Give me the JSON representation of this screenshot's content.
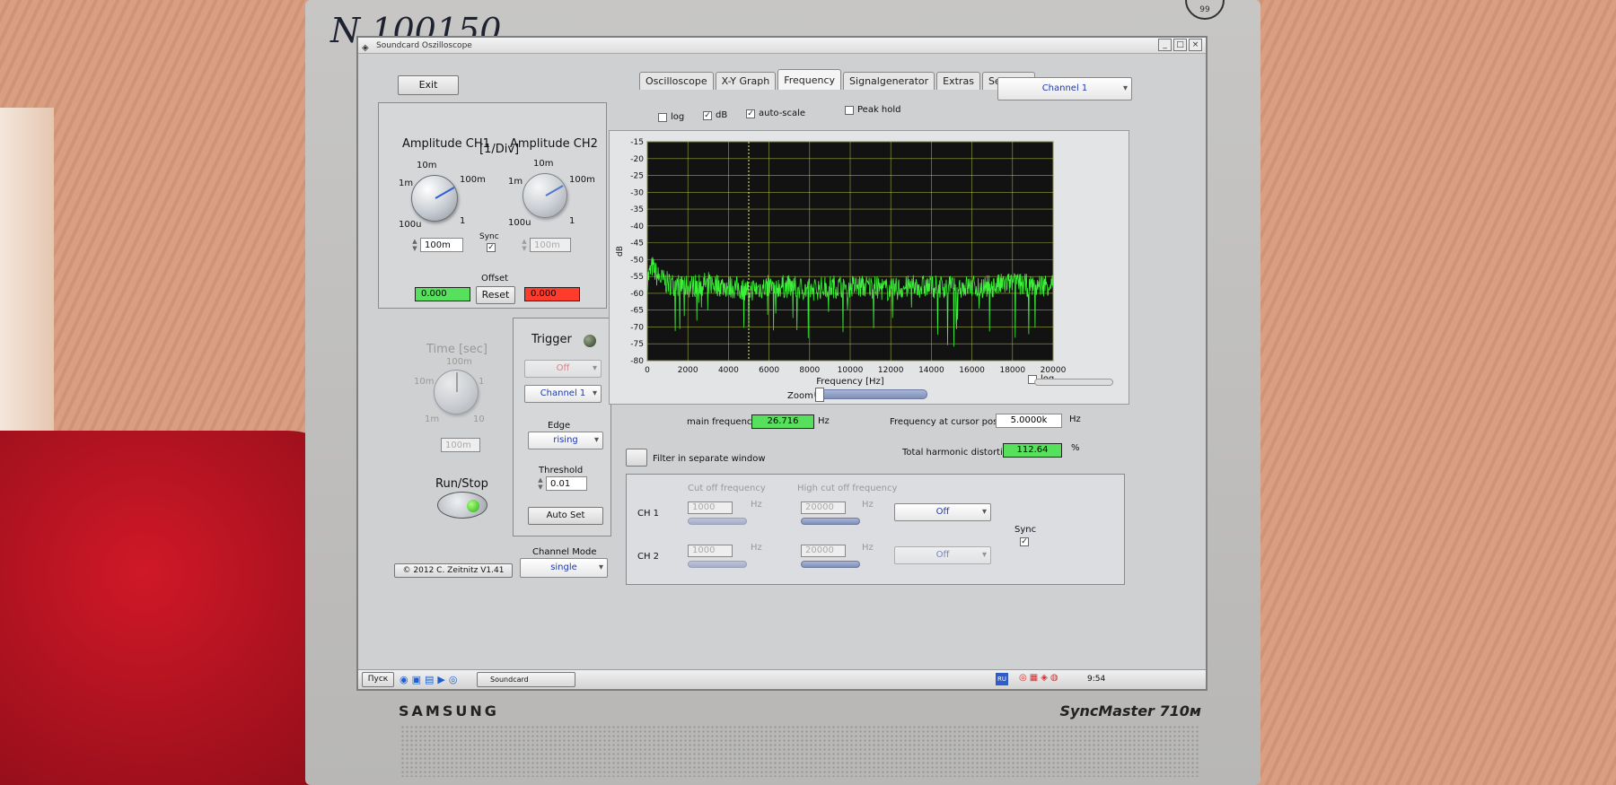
{
  "photo": {
    "handwriting": "N 100150",
    "brand": "SAMSUNG",
    "model": "SyncMaster 710м",
    "badge": "99"
  },
  "window": {
    "title": "Soundcard Oszilloscope",
    "controls": [
      "_",
      "□",
      "×"
    ]
  },
  "buttons": {
    "exit": "Exit",
    "reset": "Reset",
    "run_stop": "Run/Stop",
    "auto_set": "Auto Set",
    "copyright": "© 2012  C. Zeitnitz V1.41",
    "filter_window": "Filter in separate window"
  },
  "amplitude": {
    "ch1_label": "Amplitude CH1",
    "ch2_label": "Amplitude CH2",
    "unit": "[1/Div]",
    "scale": {
      "s100u": "100u",
      "s1m": "1m",
      "s10m": "10m",
      "s100m": "100m",
      "s1": "1"
    },
    "ch1_value": "100m",
    "ch2_value": "100m",
    "sync_label": "Sync",
    "offset_label": "Offset",
    "offset_ch1": "0.000",
    "offset_ch2": "0.000"
  },
  "time": {
    "label": "Time [sec]",
    "scale": {
      "s1m": "1m",
      "s10m": "10m",
      "s100m": "100m",
      "s1": "1",
      "s10": "10"
    },
    "value": "100m"
  },
  "trigger": {
    "label": "Trigger",
    "mode": "Off",
    "channel": "Channel 1",
    "edge_label": "Edge",
    "edge": "rising",
    "threshold_label": "Threshold",
    "threshold": "0.01",
    "channel_mode_label": "Channel Mode",
    "channel_mode": "single"
  },
  "tabs": [
    {
      "label": "Oscilloscope"
    },
    {
      "label": "X-Y Graph"
    },
    {
      "label": "Frequency"
    },
    {
      "label": "Signalgenerator"
    },
    {
      "label": "Extras"
    },
    {
      "label": "Settings"
    }
  ],
  "channel_select": "Channel 1",
  "options": {
    "log": "log",
    "db": "dB",
    "auto_scale": "auto-scale",
    "peak_hold": "Peak hold",
    "x_log": "log"
  },
  "chart_data": {
    "type": "line",
    "xlabel": "Frequency [Hz]",
    "ylabel": "dB",
    "xlim": [
      0,
      20000
    ],
    "ylim": [
      -80,
      -15
    ],
    "x_ticks": [
      "0",
      "2000",
      "4000",
      "6000",
      "8000",
      "10000",
      "12000",
      "14000",
      "16000",
      "18000",
      "20000"
    ],
    "y_ticks": [
      "-15",
      "-20",
      "-25",
      "-30",
      "-35",
      "-40",
      "-45",
      "-50",
      "-55",
      "-60",
      "-65",
      "-70",
      "-75",
      "-80"
    ],
    "grid": true,
    "cursor_x": 5000,
    "series": [
      {
        "color": "#3df03a",
        "x": [
          0,
          250,
          500,
          1000,
          2000,
          3000,
          4000,
          5000,
          6000,
          7000,
          8000,
          9000,
          10000,
          11000,
          12000,
          13000,
          14000,
          15000,
          16000,
          17000,
          18000,
          19000,
          20000
        ],
        "y": [
          -56,
          -52,
          -55,
          -57,
          -58,
          -57,
          -58,
          -59,
          -58,
          -58,
          -59,
          -58,
          -58,
          -58,
          -59,
          -58,
          -58,
          -58,
          -58,
          -58,
          -57,
          -58,
          -57
        ]
      }
    ]
  },
  "zoom_label": "Zoom",
  "readouts": {
    "main_freq_label": "main frequency",
    "main_freq": "26.716",
    "hz": "Hz",
    "cursor_label": "Frequency at cursor position",
    "cursor": "5.0000k",
    "thd_label": "Total harmonic distortion",
    "thd": "112.64",
    "percent": "%"
  },
  "filter": {
    "cutoff_label": "Cut off frequency",
    "high_cutoff_label": "High cut off frequency",
    "ch1": "CH 1",
    "ch2": "CH 2",
    "ch1_low": "1000",
    "ch1_high": "20000",
    "ch2_low": "1000",
    "ch2_high": "20000",
    "hz": "Hz",
    "ch1_mode": "Off",
    "ch2_mode": "Off",
    "sync_label": "Sync"
  },
  "taskbar": {
    "start": "Пуск",
    "app": "Soundcard Oszilloscope",
    "lang": "RU",
    "clock": "9:54"
  },
  "colors": {
    "trace": "#3df03a",
    "plot_bg": "#121212",
    "grid": "#c8d84a"
  }
}
